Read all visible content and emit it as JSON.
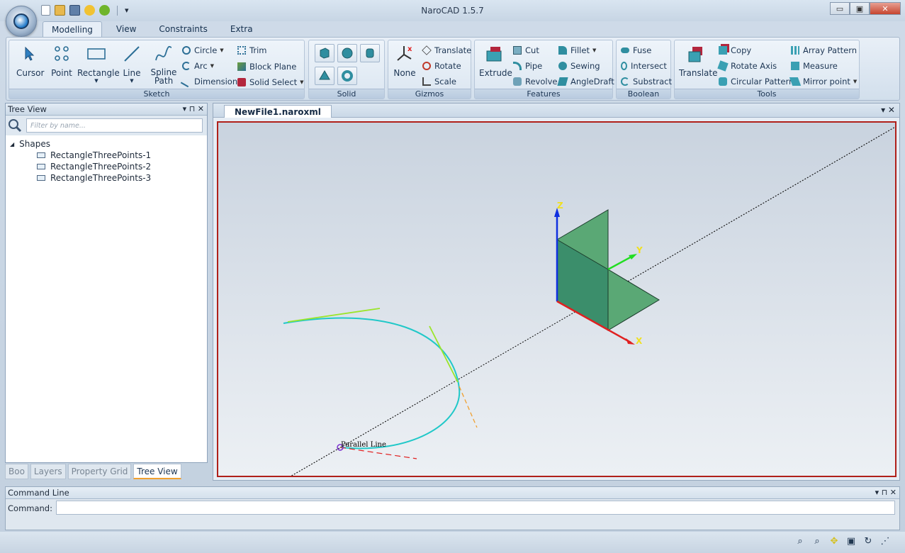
{
  "app": {
    "title": "NaroCAD 1.5.7"
  },
  "window": {
    "minimize": "▭",
    "maximize": "▣",
    "close": "✕"
  },
  "qat": {
    "more": "▾"
  },
  "tabs": [
    "Modelling",
    "View",
    "Constraints",
    "Extra"
  ],
  "ribbon": {
    "sketch": {
      "label": "Sketch",
      "cursor": "Cursor",
      "point": "Point",
      "rectangle": "Rectangle",
      "line": "Line",
      "spline": "Spline Path",
      "circle": "Circle",
      "arc": "Arc",
      "dimension": "Dimension",
      "trim": "Trim",
      "block_plane": "Block Plane",
      "solid_select": "Solid Select"
    },
    "solid": {
      "label": "Solid"
    },
    "gizmos": {
      "label": "Gizmos",
      "none": "None",
      "translate": "Translate",
      "rotate": "Rotate",
      "scale": "Scale"
    },
    "features": {
      "label": "Features",
      "extrude": "Extrude",
      "cut": "Cut",
      "pipe": "Pipe",
      "revolve": "Revolve",
      "fillet": "Fillet",
      "sewing": "Sewing",
      "angledraft": "AngleDraft"
    },
    "boolean": {
      "label": "Boolean",
      "fuse": "Fuse",
      "intersect": "Intersect",
      "substract": "Substract"
    },
    "tools": {
      "label": "Tools",
      "translate": "Translate",
      "copy": "Copy",
      "rotate_axis": "Rotate Axis",
      "circular_pattern": "Circular Pattern",
      "array_pattern": "Array Pattern",
      "measure": "Measure",
      "mirror_point": "Mirror point"
    }
  },
  "tree_panel": {
    "title": "Tree View",
    "search_placeholder": "Filter by name...",
    "root": "Shapes",
    "items": [
      "RectangleThreePoints-1",
      "RectangleThreePoints-2",
      "RectangleThreePoints-3"
    ],
    "pin": "▾  ⊓  ✕"
  },
  "bottom_tabs": [
    "Boo",
    "Layers",
    "Property Grid",
    "Tree View"
  ],
  "document": {
    "tab": "NewFile1.naroxml",
    "ctl": "▾  ✕"
  },
  "viewport": {
    "axis_z": "Z",
    "axis_y": "Y",
    "axis_x": "X",
    "hint": "Parallel Line",
    "colors": {
      "x": "#e02020",
      "y": "#22dd22",
      "z": "#1030e0",
      "face": "#4a9c6e"
    }
  },
  "command": {
    "title": "Command Line",
    "label": "Command:",
    "value": "",
    "ctl": "▾  ⊓  ✕"
  }
}
